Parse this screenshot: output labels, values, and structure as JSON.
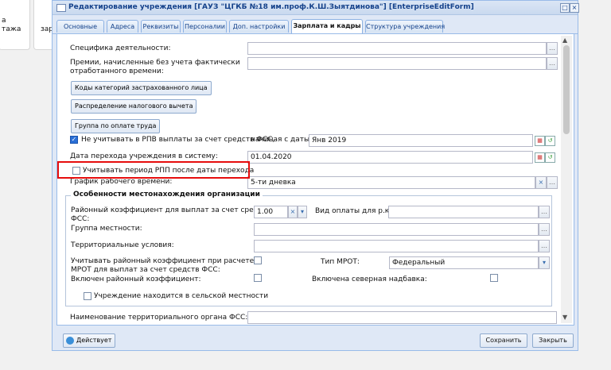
{
  "background": {
    "tile1_lines": [
      "а",
      "тажа"
    ],
    "tile2_text": "зар"
  },
  "window": {
    "title": "Редактирование учреждения [ГАУЗ \"ЦГКБ №18 им.проф.К.Ш.Зыятдинова\"] [EnterpriseEditForm]",
    "restore_symbol": "□",
    "close_symbol": "×"
  },
  "tabs": [
    "Основные",
    "Адреса",
    "Реквизиты",
    "Персоналии",
    "Доп. настройки",
    "Зарплата и кадры",
    "Структура учреждения"
  ],
  "active_tab": "Зарплата и кадры",
  "form": {
    "spec_label": "Специфика деятельности:",
    "bonus_label": [
      "Премии, начисленные без учета фактически",
      "отработанного времени:"
    ],
    "btn_codes": "Коды категорий застрахованного лица",
    "btn_tax": "Распределение налогового вычета",
    "btn_group": "Группа по оплате труда",
    "rpv_label": "Не учитывать в РПВ выплаты за счет средств ФСС,",
    "rpv_checked": true,
    "rpv_date_label": "начиная с даты:",
    "rpv_date_value": "Янв 2019",
    "transition_label": "Дата перехода учреждения в систему:",
    "transition_value": "01.04.2020",
    "rpp_label": "Учитывать период РПП после даты перехода",
    "rpp_checked": false,
    "schedule_label": "График рабочего времени:",
    "schedule_value": "5-ти дневка",
    "location_legend": "Особенности местонахождения организации",
    "district_coef_label": [
      "Районный коэффициент для выплат за счет средств",
      "ФСС:"
    ],
    "district_coef_value": "1.00",
    "payment_type_label": "Вид оплаты для р.к.:",
    "locality_group_label": "Группа местности:",
    "territorial_label": "Территориальные условия:",
    "mrot_coef_label": [
      "Учитывать районный коэффициент при расчете",
      "МРОТ для выплат за счет средств ФСС:"
    ],
    "mrot_type_label": "Тип МРОТ:",
    "mrot_type_value": "Федеральный",
    "coef_included_label": "Включен районный коэффициент:",
    "north_label": "Включена северная надбавка:",
    "rural_label": "Учреждение находится в сельской местности",
    "fss_organ_label": "Наименование территориального органа ФСС:"
  },
  "footer": {
    "active_label": "Действует",
    "save_label": "Сохранить",
    "close_label": "Закрыть"
  },
  "colors": {
    "highlight": "#e60d0d",
    "window_border": "#99bbe8",
    "title_text": "#15428b"
  }
}
